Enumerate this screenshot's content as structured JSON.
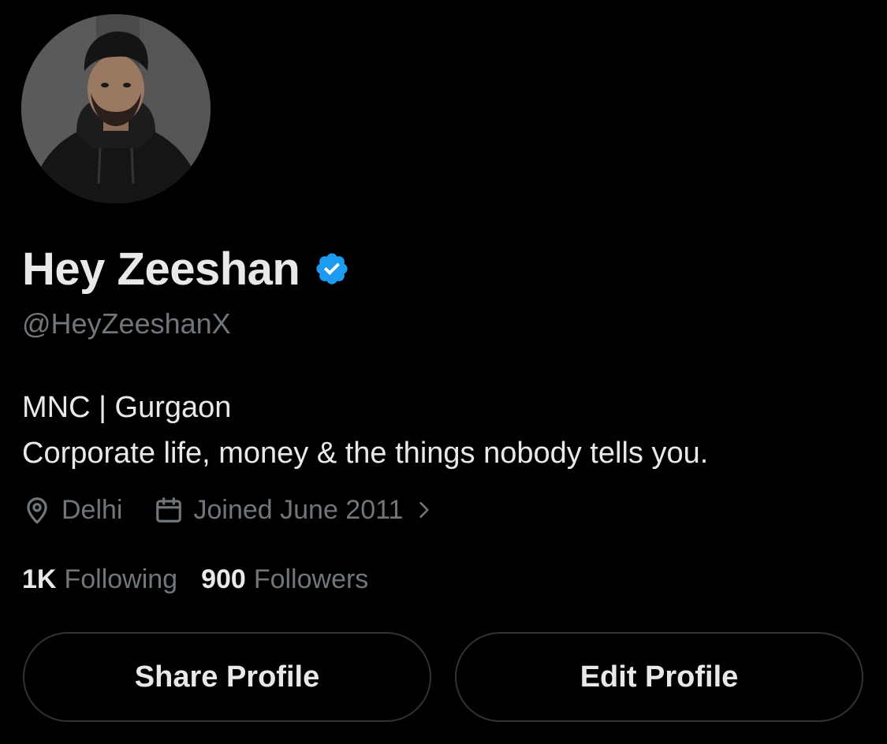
{
  "profile": {
    "display_name": "Hey Zeeshan",
    "handle": "@HeyZeeshanX",
    "verified": true,
    "bio_lines": [
      "MNC | Gurgaon",
      "Corporate life, money & the things nobody tells you."
    ],
    "location": "Delhi",
    "joined": "Joined June 2011"
  },
  "stats": {
    "following_count": "1K",
    "following_label": "Following",
    "followers_count": "900",
    "followers_label": "Followers"
  },
  "actions": {
    "share_label": "Share Profile",
    "edit_label": "Edit Profile"
  },
  "icons": {
    "verified": "verified-badge-icon",
    "location": "location-pin-icon",
    "calendar": "calendar-icon",
    "chevron": "chevron-right-icon"
  },
  "colors": {
    "background": "#000000",
    "primary_text": "#e7e9ea",
    "secondary_text": "#71767b",
    "verified_blue": "#1d9bf0",
    "button_border": "#2f3336"
  }
}
